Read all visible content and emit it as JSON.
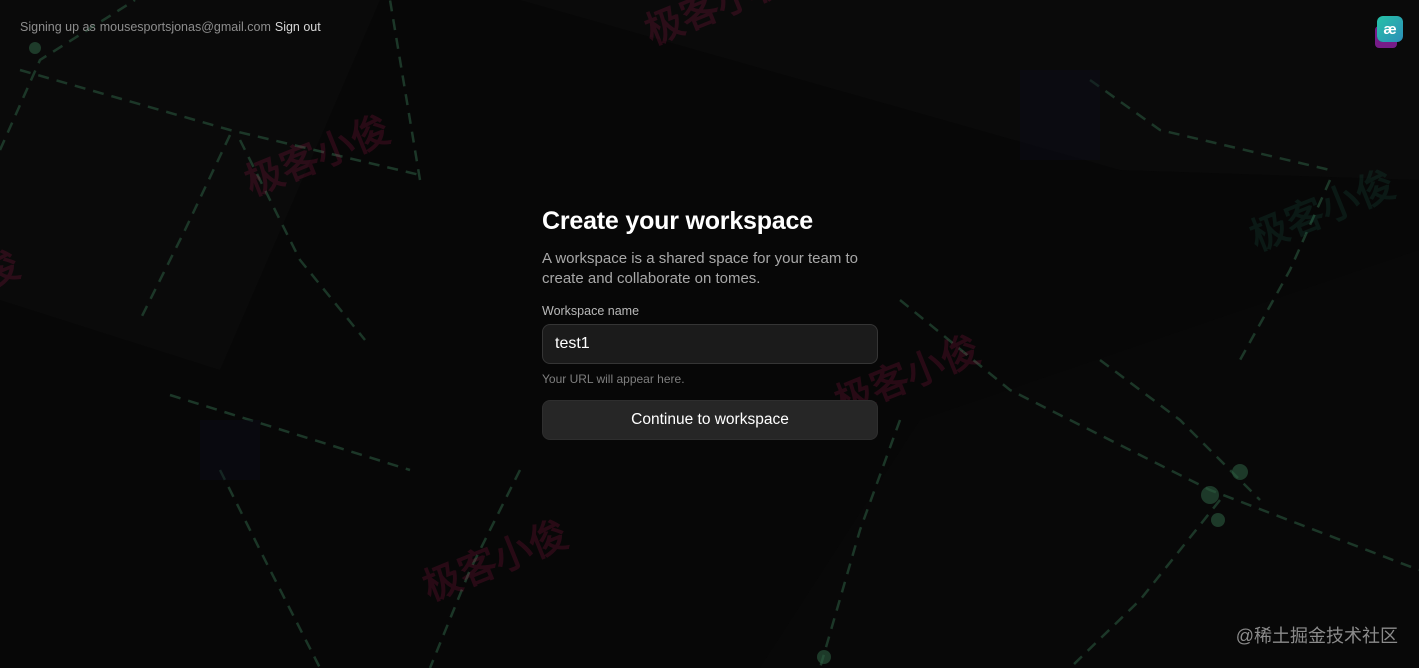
{
  "header": {
    "signing_up_prefix": "Signing up as",
    "email": "mousesportsjonas@gmail.com",
    "sign_out": "Sign out",
    "app_icon": "æ"
  },
  "main": {
    "title": "Create your workspace",
    "description": "A workspace is a shared space for your team to create and collaborate on tomes.",
    "workspace_label": "Workspace name",
    "workspace_value": "test1",
    "url_hint": "Your URL will appear here.",
    "continue_button": "Continue to workspace"
  },
  "footer": {
    "community_watermark": "@稀土掘金技术社区"
  },
  "watermarks": {
    "text": "极客小俊"
  }
}
